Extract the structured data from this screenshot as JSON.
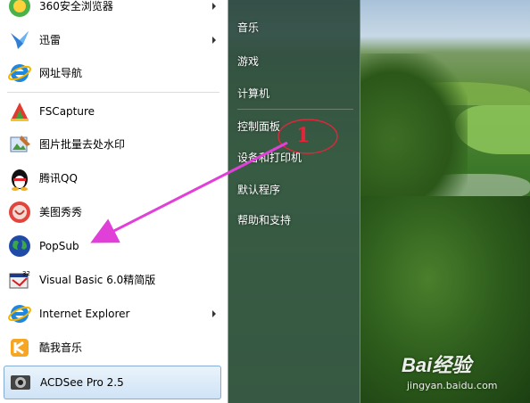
{
  "left_menu": {
    "items": [
      {
        "label": "360安全浏览器",
        "icon": "browser-360-icon",
        "has_arrow": true
      },
      {
        "label": "迅雷",
        "icon": "thunder-bird-icon",
        "has_arrow": true
      },
      {
        "label": "网址导航",
        "icon": "ie-icon",
        "has_arrow": false
      },
      {
        "label": "FSCapture",
        "icon": "fscapture-icon",
        "has_arrow": false
      },
      {
        "label": "图片批量去处水印",
        "icon": "image-tool-icon",
        "has_arrow": false
      },
      {
        "label": "腾讯QQ",
        "icon": "qq-penguin-icon",
        "has_arrow": false
      },
      {
        "label": "美图秀秀",
        "icon": "meitu-icon",
        "has_arrow": false
      },
      {
        "label": "PopSub",
        "icon": "globe-icon",
        "has_arrow": false
      },
      {
        "label": "Visual Basic 6.0精简版",
        "icon": "vb6-icon",
        "has_arrow": false
      },
      {
        "label": "Internet Explorer",
        "icon": "ie-icon",
        "has_arrow": true
      },
      {
        "label": "酷我音乐",
        "icon": "kuwo-music-icon",
        "has_arrow": false
      },
      {
        "label": "ACDSee Pro 2.5",
        "icon": "acdsee-icon",
        "has_arrow": false
      }
    ]
  },
  "right_menu": {
    "items": [
      "音乐",
      "游戏",
      "计算机",
      "控制面板",
      "设备和打印机",
      "默认程序",
      "帮助和支持"
    ]
  },
  "annotation": {
    "step_number": "1",
    "color": "#e2263a",
    "arrow_color": "#e040d8"
  },
  "watermark": {
    "logo_text": "Bai经验",
    "url": "jingyan.baidu.com"
  }
}
